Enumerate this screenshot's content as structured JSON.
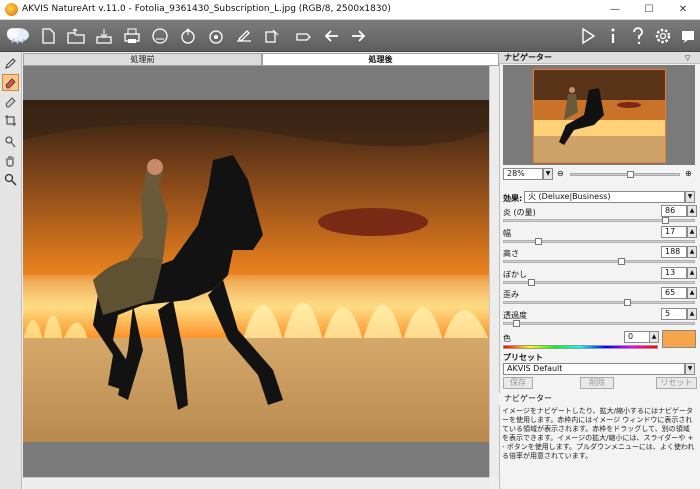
{
  "window": {
    "title": "AKVIS NatureArt v.11.0 - Fotolia_9361430_Subscription_L.jpg (RGB/8, 2500x1830)",
    "minimize": "—",
    "maximize": "☐",
    "close": "✕"
  },
  "toolbar": {
    "icons": [
      "new-file-icon",
      "open-folder-icon",
      "save-icon",
      "print-icon",
      "share-icon",
      "upload-icon",
      "settings-save-icon",
      "edit-batch-icon",
      "export-icon",
      "watermark-icon",
      "back-arrow-icon",
      "forward-arrow-icon"
    ],
    "right_icons": [
      "run-icon",
      "info-icon",
      "help-icon",
      "gear-icon",
      "chat-icon"
    ]
  },
  "tabs": {
    "before": "処理前",
    "after": "処理後"
  },
  "navigator": {
    "header": "ナビゲーター",
    "zoom": "28%"
  },
  "settings": {
    "effect_label": "効果:",
    "effect_value": "火 (Deluxe|Business)",
    "params": [
      {
        "label": "炎 (の量)",
        "value": "86",
        "fraction": 0.86
      },
      {
        "label": "幅",
        "value": "17",
        "fraction": 0.17
      },
      {
        "label": "高さ",
        "value": "188",
        "fraction": 0.62
      },
      {
        "label": "ぼかし",
        "value": "13",
        "fraction": 0.13
      },
      {
        "label": "歪み",
        "value": "65",
        "fraction": 0.65
      },
      {
        "label": "透過度",
        "value": "5",
        "fraction": 0.05
      }
    ],
    "color_label": "色",
    "color_value": "0",
    "color_swatch": "#f6a54a"
  },
  "presets": {
    "header": "プリセット",
    "selected": "AKVIS Default",
    "save": "保存",
    "delete": "削除",
    "reset": "リセット"
  },
  "hint": {
    "header": "ナビゲーター",
    "text": "イメージをナビゲートしたり、拡大/縮小するにはナビゲーターを使用します。赤枠内にはイメージ ウィンドウに表示されている領域が表示されます。赤枠をドラッグして、別の領域を表示できます。イメージの拡大/縮小には、スライダーや + - ボタンを使用します。プルダウンメニューには、よく使われる倍率が用意されています。"
  },
  "colors": {
    "accent": "#f47a2a",
    "toolbar": "#6b6b6b"
  }
}
